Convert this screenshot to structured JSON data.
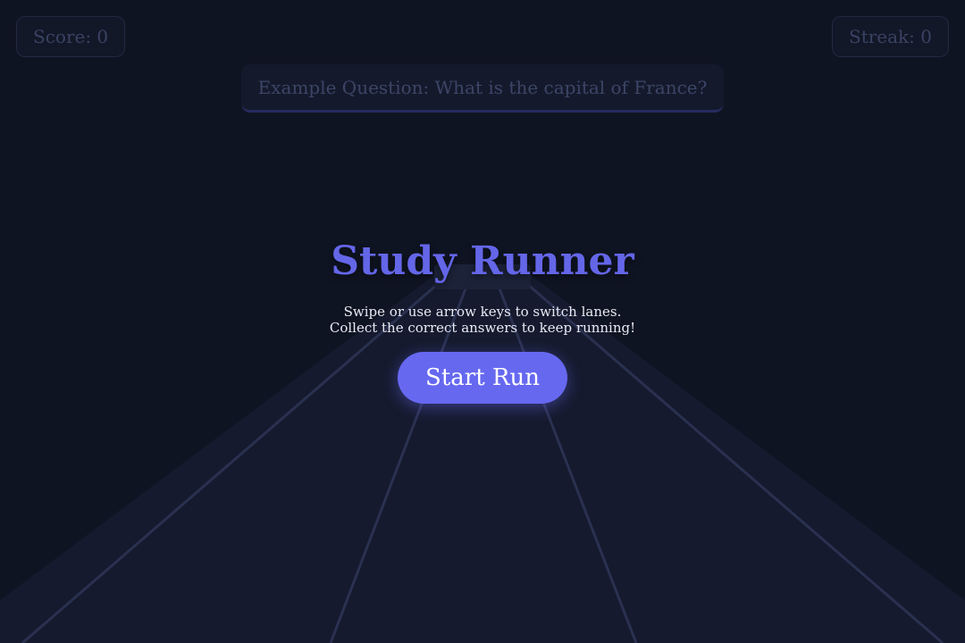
{
  "hud": {
    "score_label": "Score: 0",
    "streak_label": "Streak: 0"
  },
  "question": {
    "text": "Example Question: What is the capital of France?"
  },
  "start_screen": {
    "title": "Study Runner",
    "instructions": [
      "Swipe or use arrow keys to switch lanes.",
      "Collect the correct answers to keep running!"
    ],
    "button_label": "Start Run"
  },
  "colors": {
    "background": "#0f1422",
    "track": "#151a2e",
    "lane_line": "#2a3150",
    "accent": "#6668f0",
    "title": "#6466e8"
  }
}
